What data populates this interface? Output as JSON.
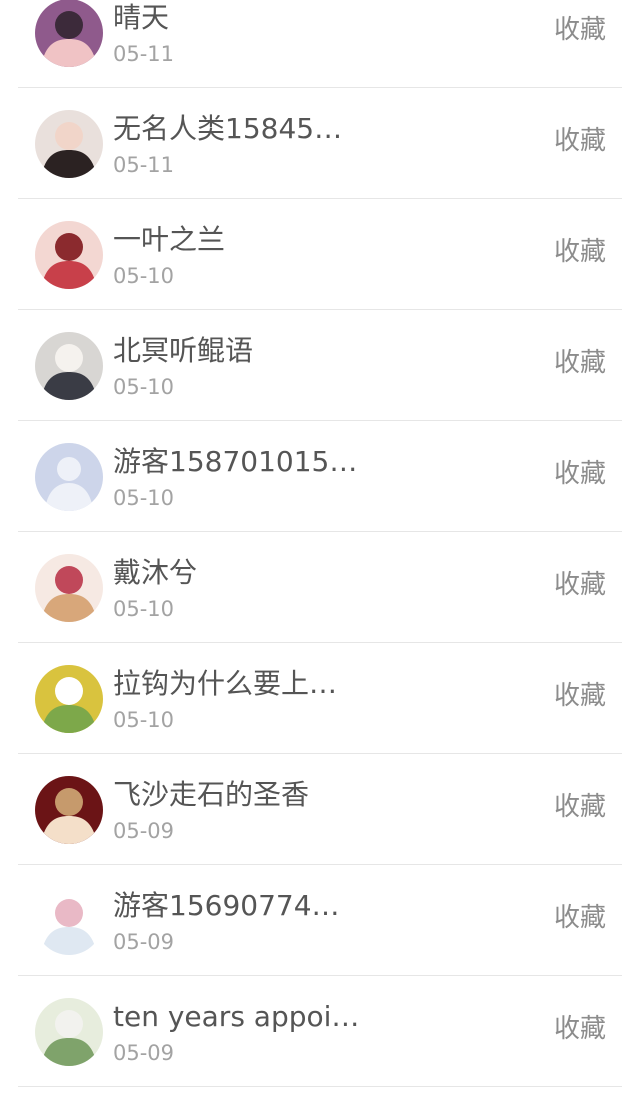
{
  "rows": [
    {
      "name": "晴天",
      "date": "05-11",
      "action": "收藏",
      "avatar": "girl-portrait-pink",
      "avatar_colors": [
        "#8f5a8c",
        "#f0c3c5",
        "#3c2a3a"
      ]
    },
    {
      "name": "无名人类15845…",
      "date": "05-11",
      "action": "收藏",
      "avatar": "girl-portrait-dark-hair",
      "avatar_colors": [
        "#e9e0dc",
        "#2b2222",
        "#f1d5c9"
      ]
    },
    {
      "name": "一叶之兰",
      "date": "05-10",
      "action": "收藏",
      "avatar": "anime-red-hair",
      "avatar_colors": [
        "#f3d7d2",
        "#c8404a",
        "#8b2a2e"
      ]
    },
    {
      "name": "北冥听鲲语",
      "date": "05-10",
      "action": "收藏",
      "avatar": "figure-dark-coat",
      "avatar_colors": [
        "#d8d6d3",
        "#3a3c45",
        "#f5f2ee"
      ]
    },
    {
      "name": "游客158701015…",
      "date": "05-10",
      "action": "收藏",
      "avatar": "default-user-silhouette",
      "avatar_colors": [
        "#cdd5ea",
        "#eef1f8",
        "#dde3f2"
      ]
    },
    {
      "name": "戴沐兮",
      "date": "05-10",
      "action": "收藏",
      "avatar": "anime-girl-flowers",
      "avatar_colors": [
        "#f6e9e3",
        "#d8a77a",
        "#c0485a"
      ]
    },
    {
      "name": "拉钩为什么要上…",
      "date": "05-10",
      "action": "收藏",
      "avatar": "game-scene-yellow",
      "avatar_colors": [
        "#d9c33e",
        "#7da84a",
        "#ffffff"
      ]
    },
    {
      "name": "飞沙走石的圣香",
      "date": "05-09",
      "action": "收藏",
      "avatar": "woman-red-curtain",
      "avatar_colors": [
        "#6b1416",
        "#f4dfc9",
        "#c69a6c"
      ]
    },
    {
      "name": "游客15690774…",
      "date": "05-09",
      "action": "收藏",
      "avatar": "anime-girl-white-hair",
      "avatar_colors": [
        "#ffffff",
        "#dfe8f2",
        "#e9b9c6"
      ]
    },
    {
      "name": "ten years appoi…",
      "date": "05-09",
      "action": "收藏",
      "avatar": "person-garden",
      "avatar_colors": [
        "#e7eddd",
        "#7fa36b",
        "#f2f2ee"
      ]
    }
  ]
}
